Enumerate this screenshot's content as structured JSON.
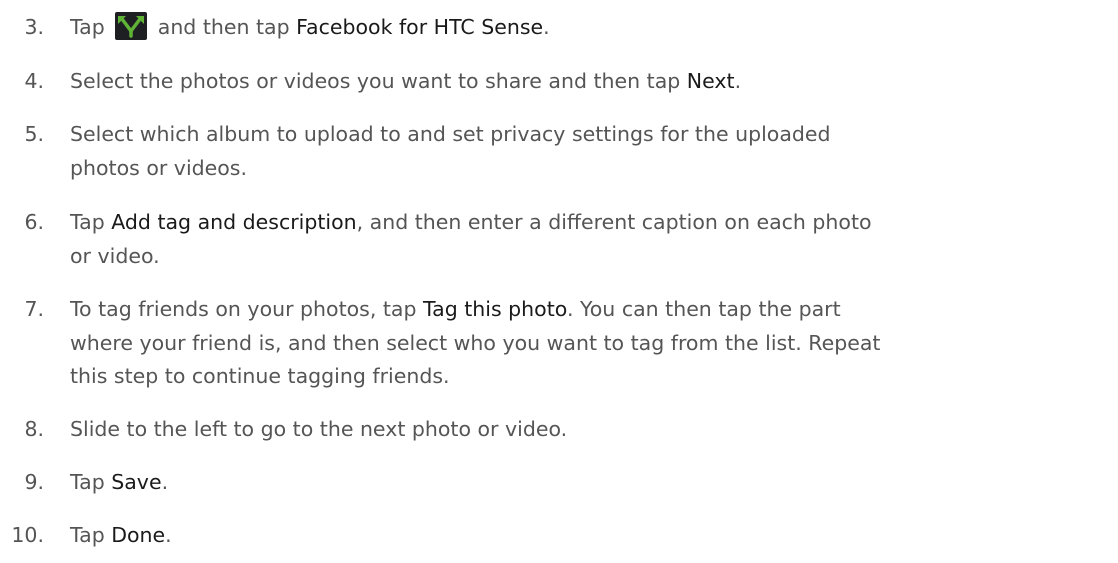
{
  "steps": [
    {
      "num": "3.",
      "parts": {
        "t0": "Tap ",
        "icon": "share-icon",
        "t1": " and then tap ",
        "h1": "Facebook for HTC Sense",
        "t2": "."
      }
    },
    {
      "num": "4.",
      "parts": {
        "t0": "Select the photos or videos you want to share and then tap ",
        "h1": "Next",
        "t1": "."
      }
    },
    {
      "num": "5.",
      "line1": "Select which album to upload to and set privacy settings for the uploaded",
      "line2": "photos or videos."
    },
    {
      "num": "6.",
      "line1_a": "Tap ",
      "line1_h": "Add tag and description",
      "line1_b": ", and then enter a different caption on each photo",
      "line2": "or video."
    },
    {
      "num": "7.",
      "line1_a": "To tag friends on your photos, tap ",
      "line1_h": "Tag this photo",
      "line1_b": ". You can then tap the part",
      "line2": "where your friend is, and then select who you want to tag from the list. Repeat",
      "line3": "this step to continue tagging friends."
    },
    {
      "num": "8.",
      "text": "Slide to the left to go to the next photo or video."
    },
    {
      "num": "9.",
      "a": "Tap ",
      "h": "Save",
      "b": "."
    },
    {
      "num": "10.",
      "a": "Tap ",
      "h": "Done",
      "b": "."
    }
  ],
  "colors": {
    "text": "#555555",
    "highlight": "#1a1a1a",
    "icon_bg": "#1e1f22",
    "icon_green": "#5fb336"
  }
}
